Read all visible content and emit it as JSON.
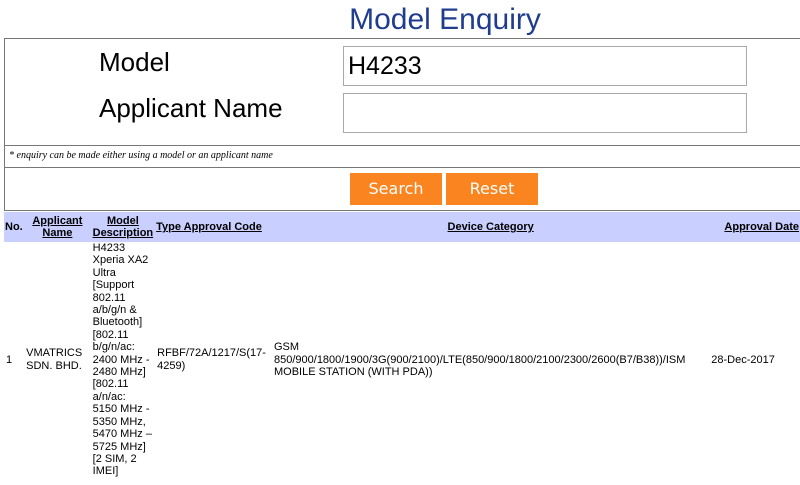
{
  "page": {
    "title": "Model Enquiry"
  },
  "form": {
    "model_label": "Model",
    "model_value": "H4233",
    "applicant_label": "Applicant Name",
    "applicant_value": "",
    "note": "* enquiry can be made either using a model or an applicant name",
    "search_label": "Search",
    "reset_label": "Reset"
  },
  "table": {
    "headers": {
      "no": "No.",
      "applicant_name": "Applicant Name",
      "model_description": "Model Description",
      "type_approval_code": "Type Approval Code",
      "device_category": "Device Category",
      "approval_date": "Approval Date"
    },
    "rows": [
      {
        "no": "1",
        "applicant_name": "VMATRICS SDN. BHD.",
        "model_description": "H4233 Xperia XA2 Ultra [Support 802.11 a/b/g/n & Bluetooth] [802.11 b/g/n/ac: 2400 MHz - 2480 MHz] [802.11 a/n/ac: 5150 MHz - 5350 MHz, 5470 MHz – 5725 MHz] [2 SIM, 2 IMEI]",
        "type_approval_code": "RFBF/72A/1217/S(17-4259)",
        "device_category": "GSM 850/900/1800/1900/3G(900/2100)/LTE(850/900/1800/2100/2300/2600(B7/B38))/ISM MOBILE STATION (WITH PDA))",
        "approval_date": "28-Dec-2017"
      }
    ]
  },
  "colors": {
    "title": "#1f3c8f",
    "button": "#f98420",
    "table_header": "#c9cfff"
  }
}
